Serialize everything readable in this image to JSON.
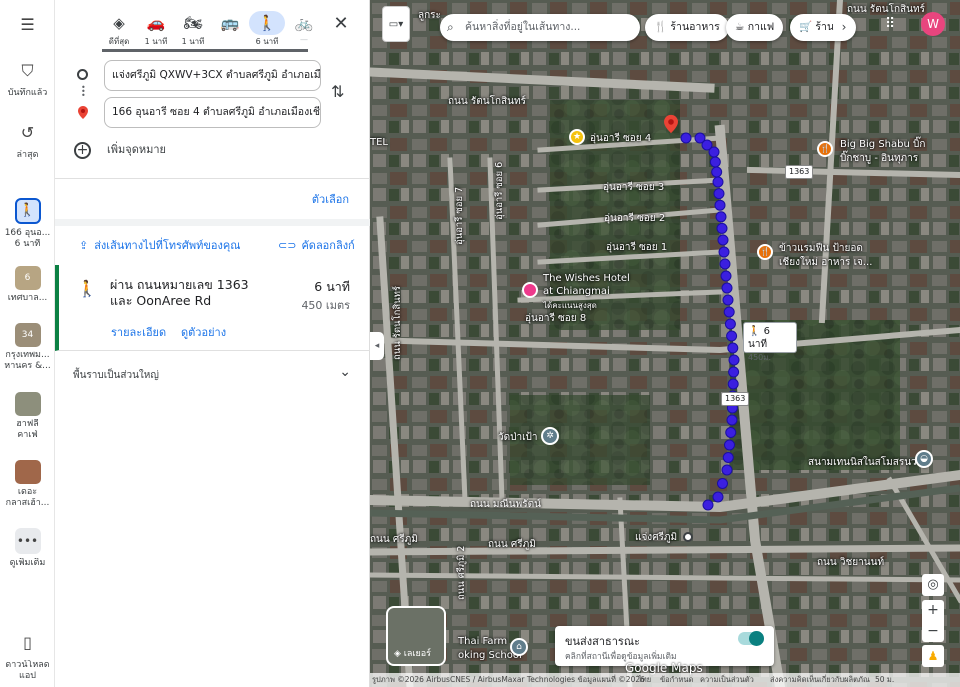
{
  "rail": {
    "saved": "บันทึกแล้ว",
    "recent": "ล่าสุด",
    "current_route": "166 อุนอ...",
    "current_route_time": "6 นาที",
    "item1": "เทศบาล...",
    "item1_badge": "6",
    "item2": "กรุงเทพม...",
    "item2b": "หานคร &...",
    "item2_badge": "34",
    "item3": "ฮาฟลี่",
    "item3b": "คาเฟ่",
    "item4": "เดอะ",
    "item4b": "กลาสเฮ้า...",
    "more": "ดูเพิ่มเติม",
    "download": "ดาวน์โหลด",
    "download2": "แอป"
  },
  "modes": [
    {
      "icon": "best-route-icon",
      "label": "ดีที่สุด"
    },
    {
      "icon": "car-icon",
      "label": "1 นาที"
    },
    {
      "icon": "motorcycle-icon",
      "label": "1 นาที"
    },
    {
      "icon": "transit-icon",
      "label": ""
    },
    {
      "icon": "walk-icon",
      "label": "6 นาที"
    },
    {
      "icon": "bicycle-icon",
      "label": "—"
    }
  ],
  "directions": {
    "origin": "แจ่งศรีภูมิ QXWV+3CX ตำบลศรีภูมิ อำเภอเมือง",
    "destination": "166 อุนอารี ซอย 4 ตำบลศรีภูมิ อำเภอเมืองเชี",
    "add_stop": "เพิ่มจุดหมาย",
    "options": "ตัวเลือก",
    "send_to_phone": "ส่งเส้นทางไปที่โทรศัพท์ของคุณ",
    "copy_link": "คัดลอกลิงก์"
  },
  "route": {
    "title": "ผ่าน ถนนหมายเลข 1363 และ OonAree Rd",
    "duration": "6 นาที",
    "distance": "450 เมตร",
    "details": "รายละเอียด",
    "preview": "ดูตัวอย่าง",
    "terrain": "พื้นราบเป็นส่วนใหญ่"
  },
  "map": {
    "search_placeholder": "ค้นหาสิ่งที่อยู่ในเส้นทาง...",
    "chip_restaurant": "ร้านอาหาร",
    "chip_cafe": "กาแฟ",
    "chip_shop": "ร้าน",
    "avatar": "W",
    "walk_time": "6 นาที",
    "walk_dist": "450ม.",
    "layers": "เลเยอร์",
    "transit_title": "ขนส่งสาธารณะ",
    "transit_sub": "คลิกที่สถานีเพื่อดูข้อมูลเพิ่มเติม",
    "route_shield": "1363",
    "labels": {
      "oonaree4": "อุ่นอารี ซอย 4",
      "oonaree3": "อุ่นอารี ซอย 3",
      "oonaree2": "อุ่นอารี ซอย 2",
      "oonaree1": "อุ่นอารี ซอย 1",
      "oonaree8": "อุ่นอารี ซอย 8",
      "oonaree6": "อุ่นอารี ซอย 6",
      "oonaree7": "อุ่นอารี ซอย 7",
      "ratchaphakhinai": "ถนน รัตนโกสินทร์",
      "ratchaphakhinai2": "ถนน รัตนโกสินทร์",
      "manee": "ถนน มณีนพรัตน์",
      "sriphum": "ถนน ศรีภูมิ",
      "sriphum2": "ถนน ศรีภูมิ",
      "wichayanon": "ถนน วิชยานนท์",
      "bigbig1": "Big Big Shabu บิ๊ก",
      "bigbig2": "บิ๊กชาบู - อินทุภาร",
      "wishes1": "The Wishes Hotel",
      "wishes2": "at Chiangmai",
      "wishes3": "ได้คะแนนสูงสุด",
      "khaoman1": "ข้าวแรมฟืน ป้ายอด",
      "khaoman2": "เชียงใหม่ อาหาร เจ...",
      "watpao": "วัดป่าเป้า",
      "tennis": "สนามเทนนิสในสโมสรนวรัฐ",
      "jaeng": "แจ่งศรีภูมิ",
      "thaifarm1": "Thai Farm",
      "thaifarm2": "oking School",
      "sriphum_v": "ถนน ศรีภูมิ 2",
      "raj_v": "ถนน รัตนโกสินทร์",
      "labeled_tel": "TEL",
      "upper": "ลูกระ"
    },
    "footer": {
      "attribution": "รูปภาพ ©2026 AirbusCNES / AirbusMaxar Technologies ข้อมูลแผนที่ ©2026",
      "thai": "ไทย",
      "terms": "ข้อกำหนด",
      "privacy": "ความเป็นส่วนตัว",
      "feedback": "ส่งความคิดเห็นเกี่ยวกับผลิตภัณฑ์",
      "scale": "50 ม.",
      "google": "Google Maps"
    }
  }
}
